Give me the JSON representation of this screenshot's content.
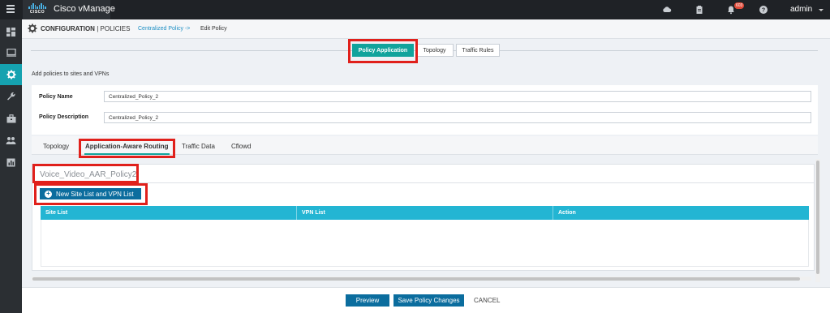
{
  "app": {
    "title": "Cisco vManage",
    "logo_text": "CISCO",
    "notification_count": "603",
    "user": "admin"
  },
  "sidebar": {
    "items": [
      {
        "icon": "dashboard-icon"
      },
      {
        "icon": "monitor-icon"
      },
      {
        "icon": "gear-icon",
        "active": true
      },
      {
        "icon": "wrench-icon"
      },
      {
        "icon": "briefcase-icon"
      },
      {
        "icon": "users-icon"
      },
      {
        "icon": "analytics-icon"
      }
    ]
  },
  "header": {
    "section": "CONFIGURATION",
    "subsection": "| POLICIES",
    "breadcrumb_link": "Centralized Policy ->",
    "breadcrumb_current": "Edit Policy"
  },
  "page_tabs": [
    {
      "label": "Policy Application",
      "active": true
    },
    {
      "label": "Topology",
      "active": false
    },
    {
      "label": "Traffic Rules",
      "active": false
    }
  ],
  "section_label": "Add policies to sites and VPNs",
  "form": {
    "policy_name_label": "Policy Name",
    "policy_name_value": "Centralized_Policy_2",
    "policy_description_label": "Policy Description",
    "policy_description_value": "Centralized_Policy_2"
  },
  "inner_tabs": [
    {
      "label": "Topology",
      "active": false
    },
    {
      "label": "Application-Aware Routing",
      "active": true
    },
    {
      "label": "Traffic Data",
      "active": false
    },
    {
      "label": "Cflowd",
      "active": false
    }
  ],
  "aar": {
    "policy_title": "Voice_Video_AAR_Policy2",
    "new_button": "New Site List and VPN List",
    "columns": [
      "Site List",
      "VPN List",
      "Action"
    ]
  },
  "footer": {
    "preview": "Preview",
    "save": "Save Policy Changes",
    "cancel": "CANCEL"
  },
  "colors": {
    "topbar": "#1f2226",
    "accent_teal": "#11a39c",
    "primary_blue": "#0b6d9e",
    "table_header": "#23b5d3",
    "highlight_red": "#e0201b"
  }
}
